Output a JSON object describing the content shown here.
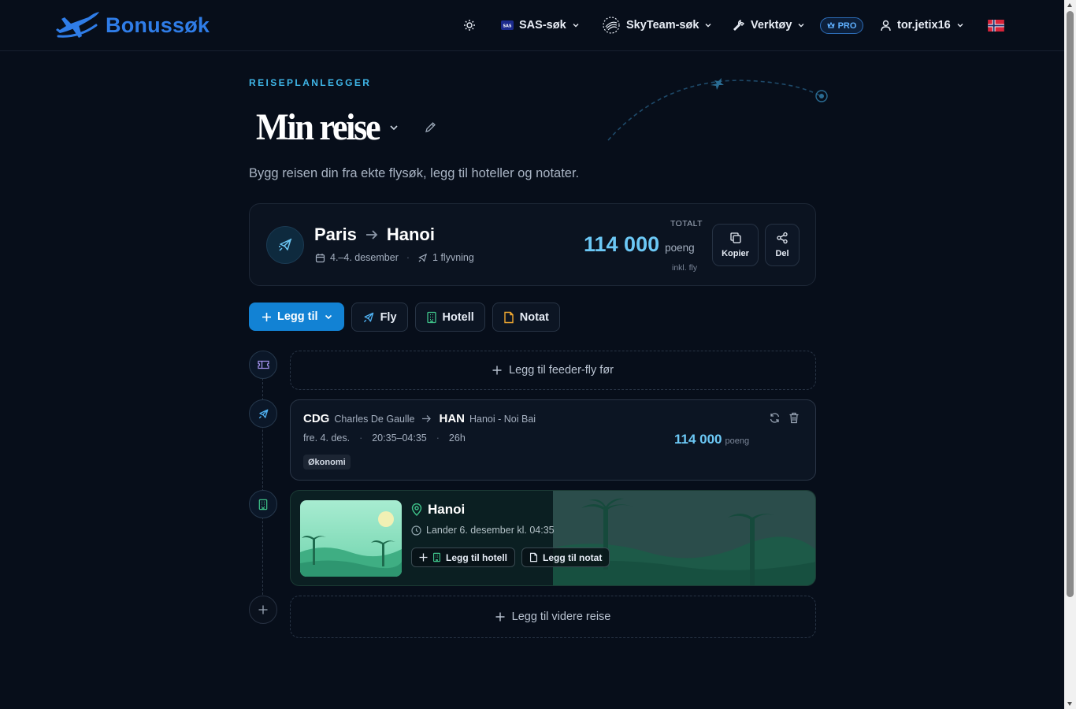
{
  "app": {
    "name": "Bonussøk"
  },
  "nav": {
    "sas_label": "SAS-søk",
    "skyteam_label": "SkyTeam-søk",
    "tools_label": "Verktøy",
    "pro_label": "PRO",
    "user_label": "tor.jetix16"
  },
  "page": {
    "eyebrow": "REISEPLANLEGGER",
    "title": "Min reise",
    "subtitle": "Bygg reisen din fra ekte flysøk, legg til hoteller og notater."
  },
  "summary": {
    "from": "Paris",
    "to": "Hanoi",
    "dates": "4.–4. desember",
    "flights": "1 flyvning",
    "total_label": "TOTALT",
    "total_value": "114 000",
    "total_unit": "poeng",
    "total_sub": "inkl. fly",
    "copy_label": "Kopier",
    "share_label": "Del"
  },
  "actions": {
    "add_label": "Legg til",
    "fly_label": "Fly",
    "hotel_label": "Hotell",
    "note_label": "Notat"
  },
  "timeline": {
    "feeder_label": "Legg til feeder-fly før",
    "flight": {
      "from_code": "CDG",
      "from_name": "Charles De Gaulle",
      "to_code": "HAN",
      "to_name": "Hanoi - Noi Bai",
      "day": "fre. 4. des.",
      "time": "20:35–04:35",
      "duration": "26h",
      "cabin": "Økonomi",
      "points": "114 000",
      "points_unit": "poeng"
    },
    "destination": {
      "name": "Hanoi",
      "landing": "Lander 6. desember kl. 04:35",
      "add_hotel_label": "Legg til hotell",
      "add_note_label": "Legg til notat"
    },
    "continue_label": "Legg til videre reise"
  },
  "colors": {
    "background": "#070e1a",
    "accent": "#1282d4",
    "points": "#6cc8f5",
    "brand": "#2f7de8"
  }
}
